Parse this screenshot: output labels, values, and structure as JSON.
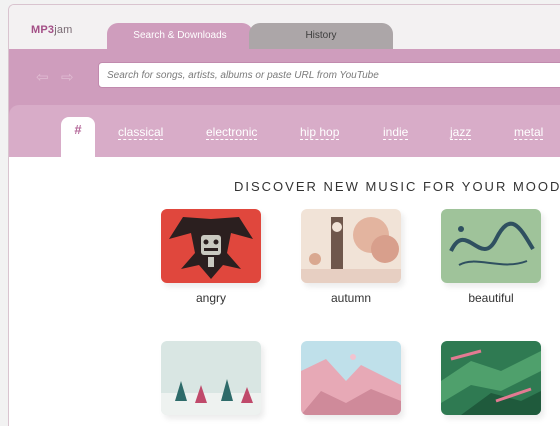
{
  "app": {
    "logo_main": "MP3",
    "logo_suffix": "jam"
  },
  "tabs": [
    {
      "label": "Search & Downloads",
      "active": true
    },
    {
      "label": "History",
      "active": false
    }
  ],
  "toolbar": {
    "back_icon": "arrow-left-icon",
    "forward_icon": "arrow-right-icon",
    "search_placeholder": "Search for songs, artists, albums or paste URL from YouTube"
  },
  "genres": {
    "hash_label": "#",
    "items": [
      "classical",
      "electronic",
      "hip hop",
      "indie",
      "jazz",
      "metal"
    ]
  },
  "main": {
    "heading": "DISCOVER NEW MUSIC FOR YOUR MOOD",
    "moods": [
      {
        "label": "angry"
      },
      {
        "label": "autumn"
      },
      {
        "label": "beautiful"
      },
      {
        "label": ""
      },
      {
        "label": ""
      },
      {
        "label": ""
      }
    ]
  },
  "colors": {
    "accent": "#cf9dbd",
    "accent_light": "#d8acc8",
    "logo": "#a34f86",
    "inactive_tab": "#aca6a8"
  }
}
